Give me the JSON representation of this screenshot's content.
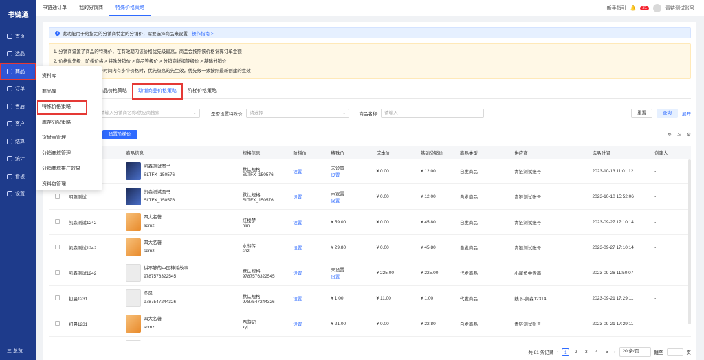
{
  "app": {
    "logo": "书链通"
  },
  "sidebar": {
    "items": [
      {
        "label": "首页",
        "active": false
      },
      {
        "label": "选品",
        "active": false
      },
      {
        "label": "商品",
        "active": true
      },
      {
        "label": "订单",
        "active": false
      },
      {
        "label": "售后",
        "active": false
      },
      {
        "label": "客户",
        "active": false
      },
      {
        "label": "结算",
        "active": false
      },
      {
        "label": "统计",
        "active": false
      },
      {
        "label": "看板",
        "active": false
      },
      {
        "label": "设置",
        "active": false
      }
    ],
    "footer": "三 总览"
  },
  "topbar": {
    "tabs": [
      "书链通订单",
      "我的分销商",
      "特殊价格策略"
    ],
    "active_tab": 2,
    "guide": "新手指引",
    "badge": "21",
    "user": "青链测试账号"
  },
  "info": {
    "text": "此功能用于给指定的分销商特定的分销价，需要选择商品来设置",
    "link": "操作指南 >"
  },
  "notice": {
    "lines": [
      "1. 分销商设置了商品的特殊价，在有效期内该价格优先级最高，商品会按照该价格计算订单金额",
      "2. 价格优先级：阶梯价格 > 特殊分销价 > 商品等级价 > 分销商折扣等级价 > 基础分销价",
      "3. 若同一分销商在同一个时间内有多个价格时，优先级高的先生效，优先级一致按照最新创建的生效"
    ]
  },
  "subtabs": {
    "items": [
      "固定商品价格策略",
      "动销商品价格策略",
      "阶梯价格策略"
    ],
    "active": 1
  },
  "filters": {
    "distributor_placeholder": "请输入分销商名称/供应商搜索",
    "special_label": "是否设置特殊价:",
    "special_placeholder": "请选择",
    "name_label": "商品名称:",
    "name_placeholder": "请输入",
    "reset": "重置",
    "query": "查询",
    "expand": "展开"
  },
  "actions": {
    "set_ladder": "设置阶梯价"
  },
  "table": {
    "headers": [
      "分销商名称",
      "商品信息",
      "规格信息",
      "阶梯价",
      "特殊价",
      "成本价",
      "基础分销价",
      "商品类型",
      "供应商",
      "选品时间",
      "创建人"
    ],
    "rows": [
      {
        "name": "",
        "title": "凯森测试图书",
        "code": "SLTFX_150576",
        "spec": "默认规格",
        "spec2": "SLTFX_150576",
        "ladder": "设置",
        "special": "未设置",
        "special2": "设置",
        "cost": "¥ 0.00",
        "base": "¥ 12.00",
        "type": "自发商品",
        "supplier": "青链测试账号",
        "time": "2023-10-13 11:01:12",
        "creator": "-",
        "thumb": "dark"
      },
      {
        "name": "明趣测试",
        "title": "凯森测试图书",
        "code": "SLTFX_150576",
        "spec": "默认规格",
        "spec2": "SLTFX_150576",
        "ladder": "设置",
        "special": "未设置",
        "special2": "设置",
        "cost": "¥ 0.00",
        "base": "¥ 12.00",
        "type": "自发商品",
        "supplier": "青链测试账号",
        "time": "2023-10-10 15:52:06",
        "creator": "-",
        "thumb": "dark"
      },
      {
        "name": "凯森测试1242",
        "title": "四大名著",
        "code": "sdmz",
        "spec": "红楼梦",
        "spec2": "hlm",
        "ladder": "设置",
        "special": "¥ 59.00",
        "special2": "",
        "cost": "¥ 0.00",
        "base": "¥ 45.80",
        "type": "自发商品",
        "supplier": "青链测试账号",
        "time": "2023-09-27 17:10:14",
        "creator": "-",
        "thumb": "orange"
      },
      {
        "name": "凯森测试1242",
        "title": "四大名著",
        "code": "sdmz",
        "spec": "水浒传",
        "spec2": "shz",
        "ladder": "设置",
        "special": "¥ 29.80",
        "special2": "",
        "cost": "¥ 0.00",
        "base": "¥ 45.80",
        "type": "自发商品",
        "supplier": "青链测试账号",
        "time": "2023-09-27 17:10:14",
        "creator": "-",
        "thumb": "orange"
      },
      {
        "name": "凯森测试1242",
        "title": "讲不够的中国神话故事",
        "code": "9787576322545",
        "spec": "默认规格",
        "spec2": "9787576322545",
        "ladder": "设置",
        "special": "未设置",
        "special2": "设置",
        "cost": "¥ 225.00",
        "base": "¥ 225.00",
        "type": "代发商品",
        "supplier": "小尾鱼中盘商",
        "time": "2023-09-26 11:50:07",
        "creator": "-",
        "thumb": "gray"
      },
      {
        "name": "初晨1231",
        "title": "冬风",
        "code": "9787547244326",
        "spec": "默认规格",
        "spec2": "9787547244326",
        "ladder": "设置",
        "special": "¥ 1.00",
        "special2": "",
        "cost": "¥ 11.00",
        "base": "¥ 1.00",
        "type": "代发商品",
        "supplier": "线下-凯森12314",
        "time": "2023-09-21 17:29:11",
        "creator": "-",
        "thumb": "gray"
      },
      {
        "name": "初晨1231",
        "title": "四大名著",
        "code": "sdmz",
        "spec": "西游记",
        "spec2": "xyj",
        "ladder": "设置",
        "special": "¥ 21.00",
        "special2": "",
        "cost": "¥ 0.00",
        "base": "¥ 22.80",
        "type": "自发商品",
        "supplier": "青链测试账号",
        "time": "2023-09-21 17:29:11",
        "creator": "-",
        "thumb": "orange"
      },
      {
        "name": "",
        "title": "北京书谱",
        "code": "",
        "spec": "默认规格",
        "spec2": "",
        "ladder": "",
        "special": "未设置",
        "special2": "",
        "cost": "",
        "base": "",
        "type": "",
        "supplier": "",
        "time": "",
        "creator": "",
        "thumb": "gray"
      }
    ]
  },
  "pager": {
    "total": "共 81 条记录",
    "pages": [
      "1",
      "2",
      "3",
      "4",
      "5"
    ],
    "active": "1",
    "size": "20 条/页",
    "jump": "跳至",
    "unit": "页"
  },
  "dropdown": {
    "items": [
      "资料库",
      "商品库",
      "特殊价格策略",
      "库存分配策略",
      "货盘表管理",
      "分销商城管理",
      "分销商城推广效果",
      "资料包管理"
    ],
    "highlight": 2
  }
}
